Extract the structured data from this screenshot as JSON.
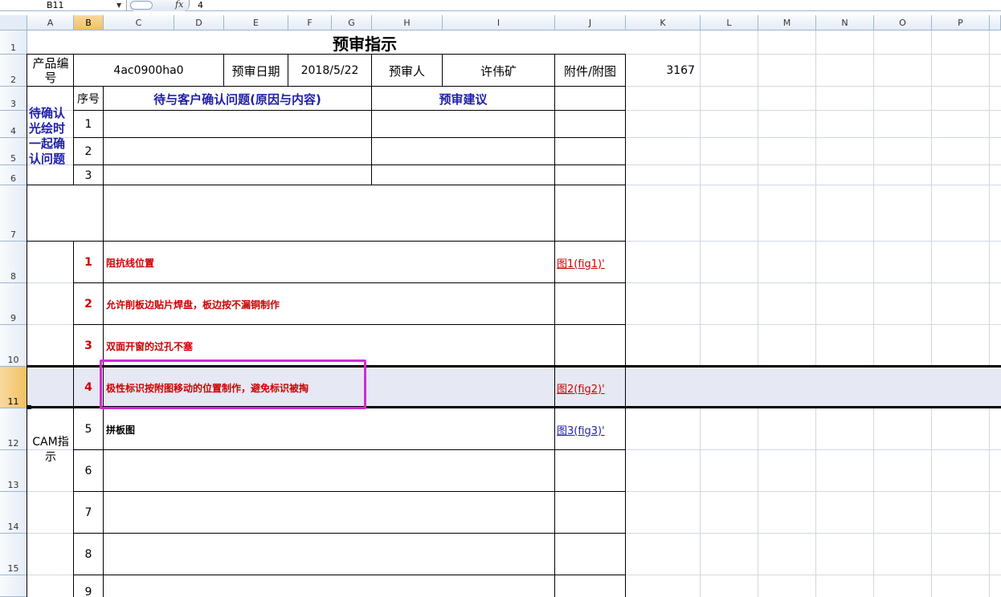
{
  "formula_bar": {
    "name_box": "B11",
    "fx_label": "fx",
    "value": "4"
  },
  "columns": [
    "A",
    "B",
    "C",
    "D",
    "E",
    "F",
    "G",
    "H",
    "I",
    "J",
    "K",
    "L",
    "M",
    "N",
    "O",
    "P"
  ],
  "selected_column": "B",
  "rows": [
    "1",
    "2",
    "3",
    "4",
    "5",
    "6",
    "7",
    "8",
    "9",
    "10",
    "11",
    "12",
    "13",
    "14",
    "15"
  ],
  "selected_row": "11",
  "sheet": {
    "title": "预审指示",
    "product_label": "产品编号",
    "product_value": "4ac0900ha0",
    "review_date_label": "预审日期",
    "review_date_value": "2018/5/22",
    "reviewer_label": "预审人",
    "reviewer_value": "许伟矿",
    "attachment_label": "附件/附图",
    "k2_value": "3167",
    "pending_label": "待确认光绘时一起确认问题",
    "seq_label": "序号",
    "issue_header": "待与客户确认问题(原因与内容)",
    "suggestion_header": "预审建议",
    "pending_seq": [
      "1",
      "2",
      "3"
    ],
    "cam_label": "CAM指示",
    "cam_rows": [
      {
        "no": "1",
        "text": "阻抗线位置",
        "link": "图1(fig1)'",
        "style": "red"
      },
      {
        "no": "2",
        "text": "允许削板边贴片焊盘，板边按不漏铜制作",
        "link": "",
        "style": "red"
      },
      {
        "no": "3",
        "text": "双面开窗的过孔不塞",
        "link": "",
        "style": "red"
      },
      {
        "no": "4",
        "text": "极性标识按附图移动的位置制作，避免标识被掏",
        "link": "图2(fig2)'",
        "style": "red"
      },
      {
        "no": "5",
        "text": "拼板图",
        "link": "图3(fig3)'",
        "style": "black"
      },
      {
        "no": "6",
        "text": "",
        "link": "",
        "style": "black"
      },
      {
        "no": "7",
        "text": "",
        "link": "",
        "style": "black"
      },
      {
        "no": "8",
        "text": "",
        "link": "",
        "style": "black"
      },
      {
        "no": "9",
        "text": "",
        "link": "",
        "style": "black"
      }
    ]
  },
  "colors": {
    "highlight": "#d22ad6",
    "header_blue": "#1f1fa8",
    "text_red": "#cc0000",
    "selection_orange": "#f1c15f"
  }
}
